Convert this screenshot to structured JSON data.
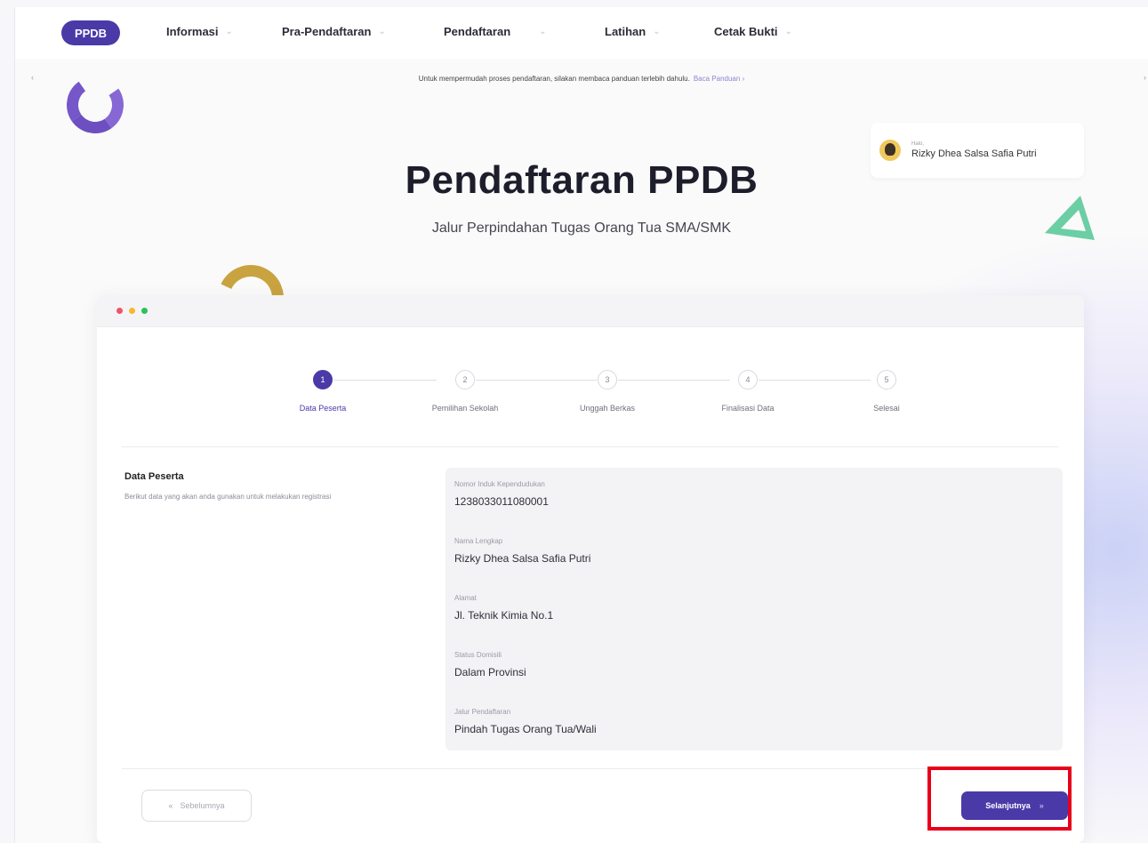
{
  "navbar": {
    "logo": "PPDB",
    "items": [
      {
        "label": "Informasi"
      },
      {
        "label": "Pra-Pendaftaran"
      },
      {
        "label": "Pendaftaran"
      },
      {
        "label": "Latihan"
      },
      {
        "label": "Cetak Bukti"
      }
    ]
  },
  "notice": {
    "text": "Untuk mempermudah proses pendaftaran, silakan membaca panduan terlebih dahulu.",
    "link_label": "Baca Panduan"
  },
  "hero": {
    "title": "Pendaftaran PPDB",
    "subtitle": "Jalur Perpindahan Tugas Orang Tua SMA/SMK"
  },
  "user": {
    "greeting": "Halo,",
    "name": "Rizky Dhea Salsa Safia Putri"
  },
  "stepper": {
    "steps": [
      {
        "number": "1",
        "label": "Data Peserta",
        "active": true
      },
      {
        "number": "2",
        "label": "Pemilihan Sekolah",
        "active": false
      },
      {
        "number": "3",
        "label": "Unggah Berkas",
        "active": false
      },
      {
        "number": "4",
        "label": "Finalisasi Data",
        "active": false
      },
      {
        "number": "5",
        "label": "Selesai",
        "active": false
      }
    ]
  },
  "section": {
    "title": "Data Peserta",
    "description": "Berikut data yang akan anda gunakan untuk melakukan registrasi"
  },
  "fields": [
    {
      "label": "Nomor Induk Kependudukan",
      "value": "1238033011080001"
    },
    {
      "label": "Nama Lengkap",
      "value": "Rizky Dhea Salsa Safia Putri"
    },
    {
      "label": "Alamat",
      "value": "Jl. Teknik Kimia No.1"
    },
    {
      "label": "Status Domisili",
      "value": "Dalam Provinsi"
    },
    {
      "label": "Jalur Pendaftaran",
      "value": "Pindah Tugas Orang Tua/Wali"
    }
  ],
  "buttons": {
    "prev": "Sebelumnya",
    "next": "Selanjutnya"
  },
  "colors": {
    "primary": "#4a3aa8",
    "window_dot_red": "#f0536a",
    "window_dot_yellow": "#f5b82e",
    "window_dot_green": "#2bc25b",
    "highlight": "#e8001b"
  }
}
